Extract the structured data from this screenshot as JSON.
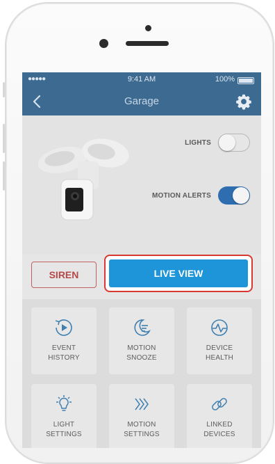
{
  "status": {
    "signal": "●●●●●",
    "time": "9:41 AM",
    "battery": "100%"
  },
  "nav": {
    "title": "Garage"
  },
  "toggles": [
    {
      "label": "LIGHTS",
      "on": false
    },
    {
      "label": "MOTION ALERTS",
      "on": true
    }
  ],
  "actions": {
    "siren_label": "SIREN",
    "live_view_label": "LIVE VIEW"
  },
  "tiles": [
    {
      "label_line1": "EVENT",
      "label_line2": "HISTORY",
      "icon": "event-history-icon"
    },
    {
      "label_line1": "MOTION",
      "label_line2": "SNOOZE",
      "icon": "moon-icon"
    },
    {
      "label_line1": "DEVICE",
      "label_line2": "HEALTH",
      "icon": "heartbeat-icon"
    },
    {
      "label_line1": "LIGHT",
      "label_line2": "SETTINGS",
      "icon": "light-bulb-icon"
    },
    {
      "label_line1": "MOTION",
      "label_line2": "SETTINGS",
      "icon": "motion-chevrons-icon"
    },
    {
      "label_line1": "LINKED",
      "label_line2": "DEVICES",
      "icon": "link-icon"
    }
  ],
  "colors": {
    "nav": "#3d6a91",
    "accent": "#1e95d8",
    "siren": "#b54848",
    "toggle_on": "#2e6eb0",
    "highlight": "#d9372f"
  }
}
